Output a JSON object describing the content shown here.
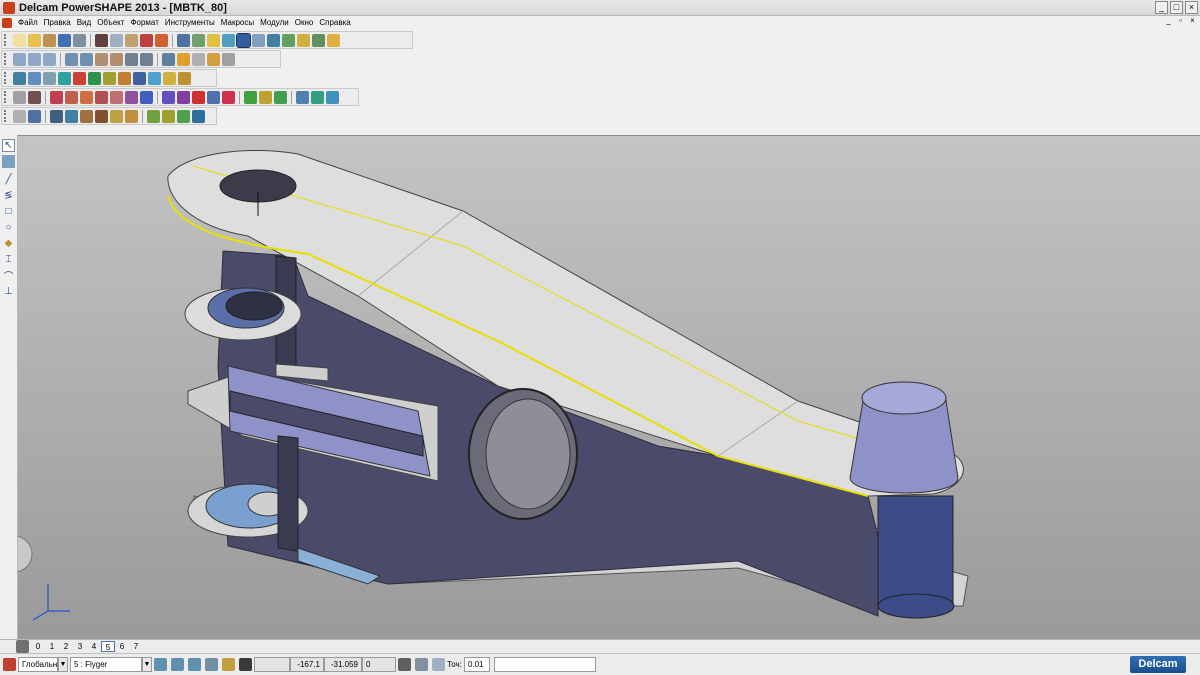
{
  "window": {
    "title": "Delcam PowerSHAPE 2013 - [MBTK_80]",
    "controls": [
      "_",
      "□",
      "×"
    ]
  },
  "menu": {
    "items": [
      "Файл",
      "Правка",
      "Вид",
      "Объект",
      "Формат",
      "Инструменты",
      "Макросы",
      "Модули",
      "Окно",
      "Справка"
    ],
    "doc_controls": [
      "_",
      "▫",
      "×"
    ]
  },
  "levels": {
    "items": [
      "0",
      "1",
      "2",
      "3",
      "4",
      "5",
      "6",
      "7"
    ],
    "active": "5"
  },
  "status": {
    "workplane": "Глобальна",
    "level_value": "5   : Flyger",
    "coord_x": "-167.1",
    "coord_y": "-31.059",
    "coord_z": "0",
    "tolerance_label": "Точ:",
    "tolerance": "0.01",
    "brand": "Delcam"
  },
  "colors": {
    "part_face": "#4a4b6a",
    "part_light": "#d9d9d9",
    "part_blue": "#7aa0d0",
    "highlight": "#e8e000",
    "viewport_top": "#c4c4c4",
    "viewport_bottom": "#9a9a9a"
  }
}
